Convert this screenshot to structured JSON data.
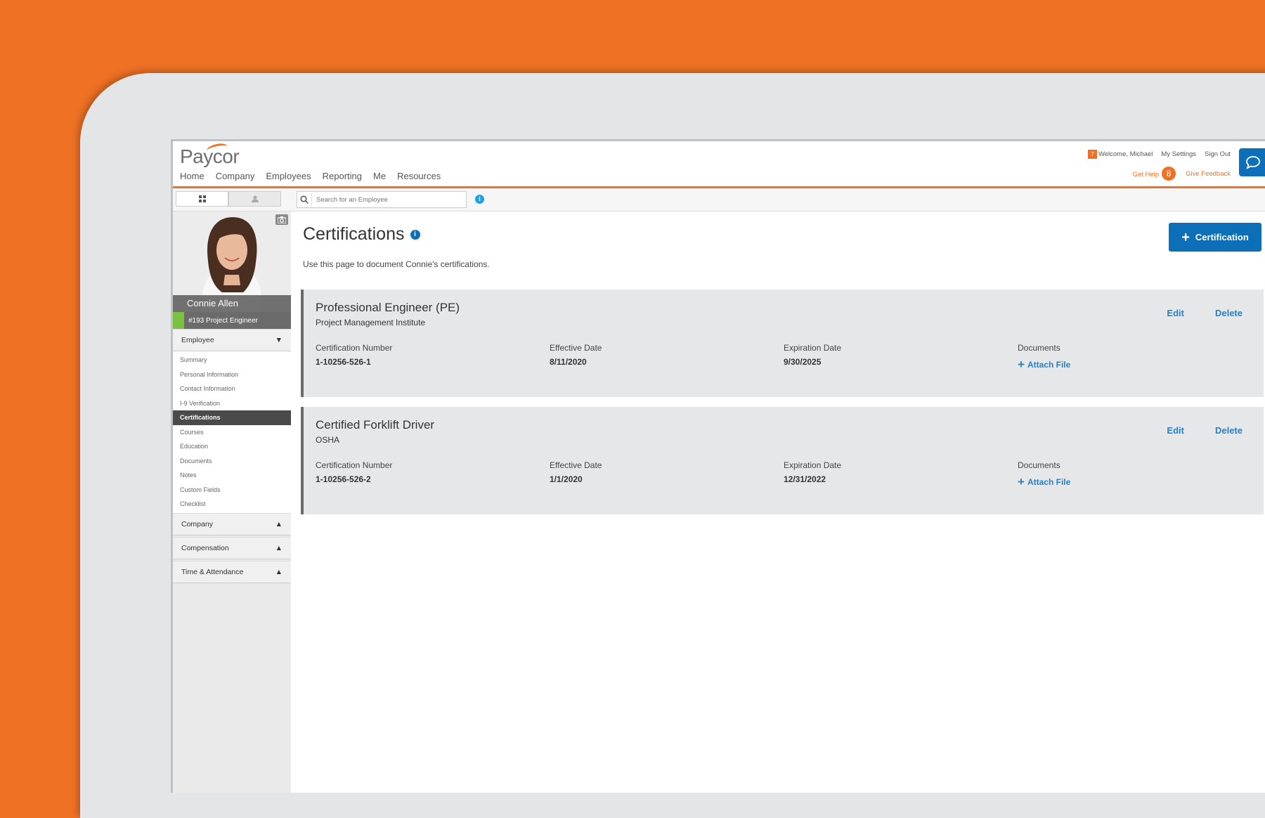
{
  "header": {
    "logo": "Paycor",
    "nav": [
      "Home",
      "Company",
      "Employees",
      "Reporting",
      "Me",
      "Resources"
    ],
    "welcome": "Welcome, Michael",
    "notification_badge": "7",
    "my_settings": "My Settings",
    "sign_out": "Sign Out",
    "get_help": "Get Help",
    "help_count": "8",
    "give_feedback": "Give Feedback"
  },
  "toolbar": {
    "search_placeholder": "Search for an Employee",
    "info_icon": "i"
  },
  "employee": {
    "name": "Connie Allen",
    "position": "#193 Project Engineer"
  },
  "sidebar": {
    "employee_section": "Employee",
    "employee_items": [
      "Summary",
      "Personal Information",
      "Contact Information",
      "I-9 Verification",
      "Certifications",
      "Courses",
      "Education",
      "Documents",
      "Notes",
      "Custom Fields",
      "Checklist"
    ],
    "selected_item": "Certifications",
    "company_section": "Company",
    "compensation_section": "Compensation",
    "time_section": "Time & Attendance",
    "collapse_arrow": "▼",
    "expand_arrow": "▲"
  },
  "main": {
    "title": "Certifications",
    "info_icon": "i",
    "subtitle": "Use this page to document Connie's certifications.",
    "add_button": "Certification",
    "add_button_icon": "+",
    "labels": {
      "cert_number": "Certification Number",
      "effective": "Effective Date",
      "expiration": "Expiration Date",
      "documents": "Documents",
      "attach": "Attach File",
      "attach_icon": "+",
      "edit": "Edit",
      "delete": "Delete"
    },
    "certifications": [
      {
        "title": "Professional Engineer (PE)",
        "issuer": "Project Management Institute",
        "number": "1-10256-526-1",
        "effective": "8/11/2020",
        "expiration": "9/30/2025"
      },
      {
        "title": "Certified Forklift Driver",
        "issuer": "OSHA",
        "number": "1-10256-526-2",
        "effective": "1/1/2020",
        "expiration": "12/31/2022"
      }
    ]
  },
  "colors": {
    "brand_orange": "#ee7124",
    "primary_blue": "#0d6fb8",
    "status_green": "#7ac142"
  }
}
